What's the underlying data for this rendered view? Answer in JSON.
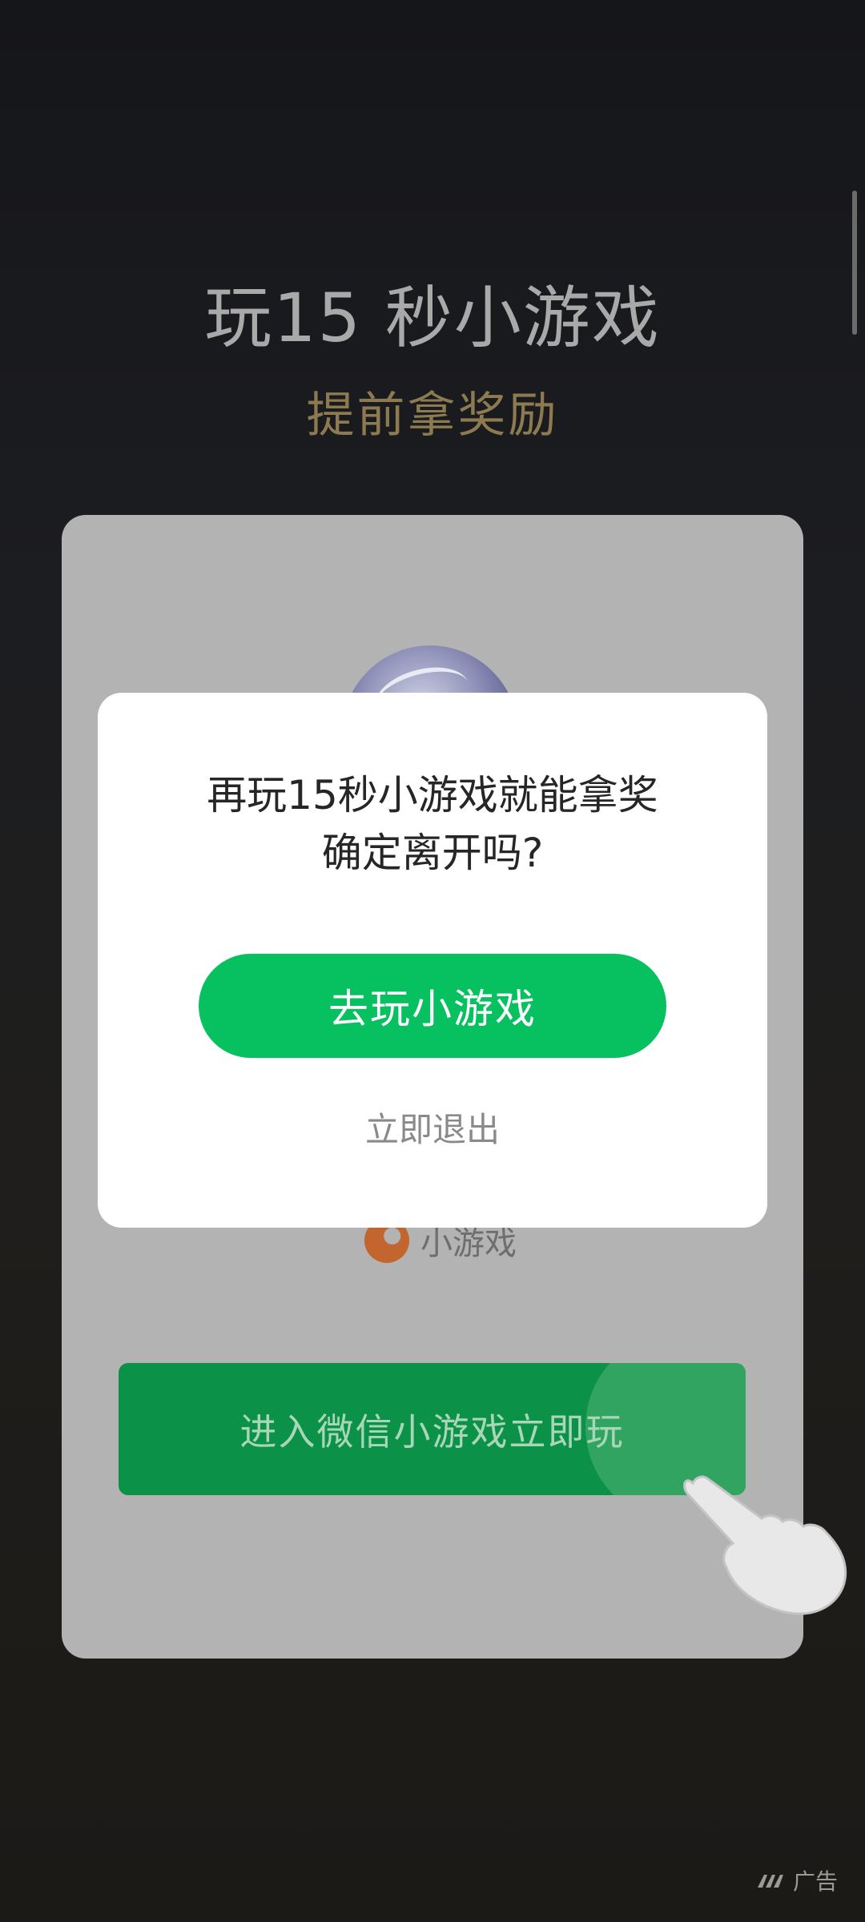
{
  "header": {
    "title": "玩15 秒小游戏",
    "subtitle": "提前拿奖励"
  },
  "card": {
    "mini_game_label": "小游戏",
    "enter_button_label": "进入微信小游戏立即玩"
  },
  "dialog": {
    "message_line1": "再玩15秒小游戏就能拿奖",
    "message_line2": "确定离开吗?",
    "primary_button_label": "去玩小游戏",
    "exit_label": "立即退出"
  },
  "ad": {
    "label": "广告"
  },
  "icons": {
    "hand": "hand-pointer-icon",
    "ad_logo": "ad-logo-icon",
    "mini_game_logo": "mini-game-logo-icon"
  },
  "colors": {
    "primary_green": "#07c160",
    "enter_button_green": "#0c9148",
    "subtitle_gold": "#8d7a51"
  }
}
